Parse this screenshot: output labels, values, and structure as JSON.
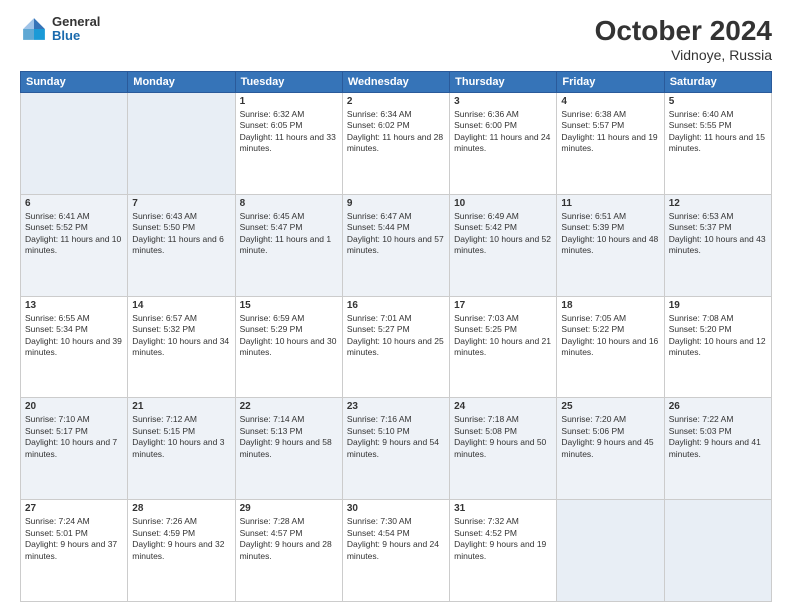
{
  "logo": {
    "text1": "General",
    "text2": "Blue"
  },
  "title": "October 2024",
  "subtitle": "Vidnoye, Russia",
  "days_of_week": [
    "Sunday",
    "Monday",
    "Tuesday",
    "Wednesday",
    "Thursday",
    "Friday",
    "Saturday"
  ],
  "weeks": [
    [
      {
        "day": "",
        "info": ""
      },
      {
        "day": "",
        "info": ""
      },
      {
        "day": "1",
        "info": "Sunrise: 6:32 AM\nSunset: 6:05 PM\nDaylight: 11 hours and 33 minutes."
      },
      {
        "day": "2",
        "info": "Sunrise: 6:34 AM\nSunset: 6:02 PM\nDaylight: 11 hours and 28 minutes."
      },
      {
        "day": "3",
        "info": "Sunrise: 6:36 AM\nSunset: 6:00 PM\nDaylight: 11 hours and 24 minutes."
      },
      {
        "day": "4",
        "info": "Sunrise: 6:38 AM\nSunset: 5:57 PM\nDaylight: 11 hours and 19 minutes."
      },
      {
        "day": "5",
        "info": "Sunrise: 6:40 AM\nSunset: 5:55 PM\nDaylight: 11 hours and 15 minutes."
      }
    ],
    [
      {
        "day": "6",
        "info": "Sunrise: 6:41 AM\nSunset: 5:52 PM\nDaylight: 11 hours and 10 minutes."
      },
      {
        "day": "7",
        "info": "Sunrise: 6:43 AM\nSunset: 5:50 PM\nDaylight: 11 hours and 6 minutes."
      },
      {
        "day": "8",
        "info": "Sunrise: 6:45 AM\nSunset: 5:47 PM\nDaylight: 11 hours and 1 minute."
      },
      {
        "day": "9",
        "info": "Sunrise: 6:47 AM\nSunset: 5:44 PM\nDaylight: 10 hours and 57 minutes."
      },
      {
        "day": "10",
        "info": "Sunrise: 6:49 AM\nSunset: 5:42 PM\nDaylight: 10 hours and 52 minutes."
      },
      {
        "day": "11",
        "info": "Sunrise: 6:51 AM\nSunset: 5:39 PM\nDaylight: 10 hours and 48 minutes."
      },
      {
        "day": "12",
        "info": "Sunrise: 6:53 AM\nSunset: 5:37 PM\nDaylight: 10 hours and 43 minutes."
      }
    ],
    [
      {
        "day": "13",
        "info": "Sunrise: 6:55 AM\nSunset: 5:34 PM\nDaylight: 10 hours and 39 minutes."
      },
      {
        "day": "14",
        "info": "Sunrise: 6:57 AM\nSunset: 5:32 PM\nDaylight: 10 hours and 34 minutes."
      },
      {
        "day": "15",
        "info": "Sunrise: 6:59 AM\nSunset: 5:29 PM\nDaylight: 10 hours and 30 minutes."
      },
      {
        "day": "16",
        "info": "Sunrise: 7:01 AM\nSunset: 5:27 PM\nDaylight: 10 hours and 25 minutes."
      },
      {
        "day": "17",
        "info": "Sunrise: 7:03 AM\nSunset: 5:25 PM\nDaylight: 10 hours and 21 minutes."
      },
      {
        "day": "18",
        "info": "Sunrise: 7:05 AM\nSunset: 5:22 PM\nDaylight: 10 hours and 16 minutes."
      },
      {
        "day": "19",
        "info": "Sunrise: 7:08 AM\nSunset: 5:20 PM\nDaylight: 10 hours and 12 minutes."
      }
    ],
    [
      {
        "day": "20",
        "info": "Sunrise: 7:10 AM\nSunset: 5:17 PM\nDaylight: 10 hours and 7 minutes."
      },
      {
        "day": "21",
        "info": "Sunrise: 7:12 AM\nSunset: 5:15 PM\nDaylight: 10 hours and 3 minutes."
      },
      {
        "day": "22",
        "info": "Sunrise: 7:14 AM\nSunset: 5:13 PM\nDaylight: 9 hours and 58 minutes."
      },
      {
        "day": "23",
        "info": "Sunrise: 7:16 AM\nSunset: 5:10 PM\nDaylight: 9 hours and 54 minutes."
      },
      {
        "day": "24",
        "info": "Sunrise: 7:18 AM\nSunset: 5:08 PM\nDaylight: 9 hours and 50 minutes."
      },
      {
        "day": "25",
        "info": "Sunrise: 7:20 AM\nSunset: 5:06 PM\nDaylight: 9 hours and 45 minutes."
      },
      {
        "day": "26",
        "info": "Sunrise: 7:22 AM\nSunset: 5:03 PM\nDaylight: 9 hours and 41 minutes."
      }
    ],
    [
      {
        "day": "27",
        "info": "Sunrise: 7:24 AM\nSunset: 5:01 PM\nDaylight: 9 hours and 37 minutes."
      },
      {
        "day": "28",
        "info": "Sunrise: 7:26 AM\nSunset: 4:59 PM\nDaylight: 9 hours and 32 minutes."
      },
      {
        "day": "29",
        "info": "Sunrise: 7:28 AM\nSunset: 4:57 PM\nDaylight: 9 hours and 28 minutes."
      },
      {
        "day": "30",
        "info": "Sunrise: 7:30 AM\nSunset: 4:54 PM\nDaylight: 9 hours and 24 minutes."
      },
      {
        "day": "31",
        "info": "Sunrise: 7:32 AM\nSunset: 4:52 PM\nDaylight: 9 hours and 19 minutes."
      },
      {
        "day": "",
        "info": ""
      },
      {
        "day": "",
        "info": ""
      }
    ]
  ]
}
